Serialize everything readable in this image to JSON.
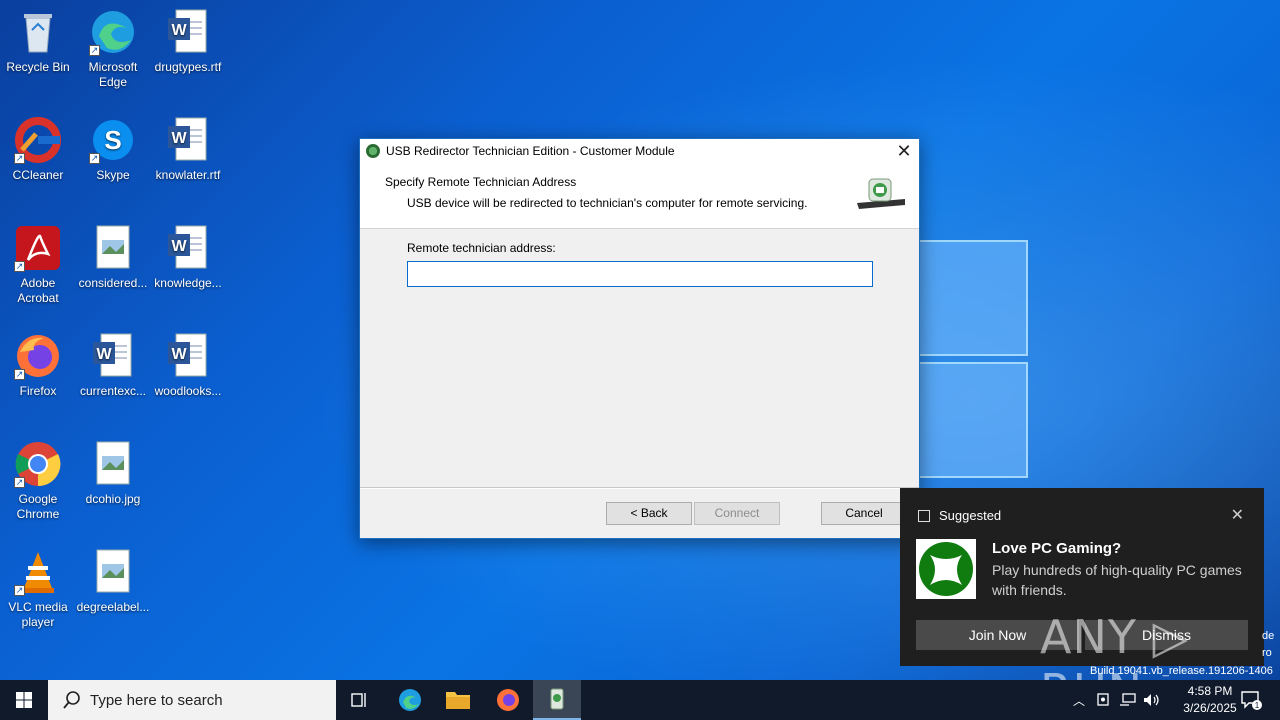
{
  "desktop": {
    "icons": [
      {
        "label": "Recycle Bin",
        "icon": "recycle-bin-icon"
      },
      {
        "label": "Microsoft Edge",
        "icon": "edge-icon"
      },
      {
        "label": "drugtypes.rtf",
        "icon": "word-doc-icon"
      },
      {
        "label": "CCleaner",
        "icon": "ccleaner-icon"
      },
      {
        "label": "Skype",
        "icon": "skype-icon"
      },
      {
        "label": "knowlater.rtf",
        "icon": "word-doc-icon"
      },
      {
        "label": "Adobe Acrobat",
        "icon": "acrobat-icon"
      },
      {
        "label": "considered...",
        "icon": "image-file-icon"
      },
      {
        "label": "knowledge...",
        "icon": "word-doc-icon"
      },
      {
        "label": "Firefox",
        "icon": "firefox-icon"
      },
      {
        "label": "currentexc...",
        "icon": "word-doc-icon"
      },
      {
        "label": "woodlooks...",
        "icon": "word-doc-icon"
      },
      {
        "label": "Google Chrome",
        "icon": "chrome-icon"
      },
      {
        "label": "dcohio.jpg",
        "icon": "image-file-icon"
      },
      {
        "label": "VLC media player",
        "icon": "vlc-icon"
      },
      {
        "label": "degreelabel...",
        "icon": "image-file-icon"
      }
    ]
  },
  "dialog": {
    "title": "USB Redirector Technician Edition - Customer Module",
    "close_glyph": "✕",
    "heading": "Specify Remote Technician Address",
    "subheading": "USB device will be redirected to technician's computer for remote servicing.",
    "field_label": "Remote technician address:",
    "field_value": "",
    "back_label": "< Back",
    "connect_label": "Connect",
    "cancel_label": "Cancel"
  },
  "notification": {
    "category": "Suggested",
    "close_glyph": "✕",
    "title": "Love PC Gaming?",
    "text": "Play hundreds of high-quality PC games with friends.",
    "primary_label": "Join Now",
    "secondary_label": "Dismiss"
  },
  "watermark": "ANY ▷ RUN",
  "build_text": "Build 19041.vb_release.191206-1406",
  "edge_text": [
    "de",
    "ro"
  ],
  "taskbar": {
    "search_placeholder": "Type here to search",
    "time": "4:58 PM",
    "date": "3/26/2025",
    "notification_count": "1"
  },
  "colors": {
    "accent": "#0a6ad0",
    "desktop_blue": "#0b66d6",
    "taskbar": "#101a2a"
  }
}
